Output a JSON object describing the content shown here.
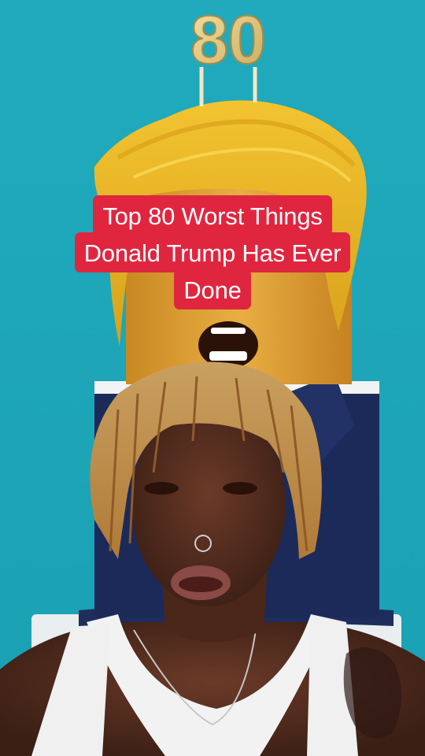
{
  "colors": {
    "background": "#1fa7b9",
    "caption_bg": "#e0263f",
    "caption_text": "#ffffff"
  },
  "cake": {
    "topper_text": "80"
  },
  "caption": {
    "lines": [
      "Top 80 Worst Things",
      "Donald Trump Has Ever",
      "Done"
    ]
  }
}
